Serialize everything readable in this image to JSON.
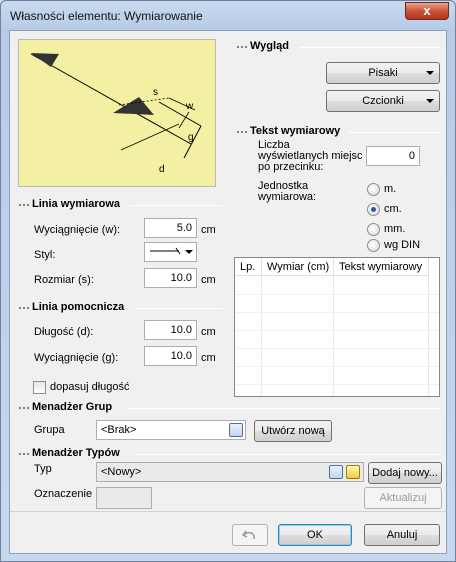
{
  "window": {
    "title": "Własności elementu: Wymiarowanie",
    "close_label": "x"
  },
  "preview": {
    "labels": {
      "s": "s",
      "w": "w",
      "g": "g",
      "d": "d"
    }
  },
  "appearance": {
    "heading": "Wygląd",
    "pens_label": "Pisaki",
    "fonts_label": "Czcionki"
  },
  "dim_text": {
    "heading": "Tekst wymiarowy",
    "decimals_label_1": "Liczba",
    "decimals_label_2": "wyświetlanych miejsc",
    "decimals_label_3": "po przecinku:",
    "decimals_value": "0",
    "unit_label_1": "Jednostka",
    "unit_label_2": "wymiarowa:",
    "units": [
      {
        "label": "m.",
        "checked": false
      },
      {
        "label": "cm.",
        "checked": true
      },
      {
        "label": "mm.",
        "checked": false
      },
      {
        "label": "wg DIN",
        "checked": false
      }
    ]
  },
  "dim_line": {
    "heading": "Linia wymiarowa",
    "extension_label": "Wyciągnięcie (w):",
    "extension_value": "5.0",
    "extension_unit": "cm",
    "style_label": "Styl:",
    "size_label": "Rozmiar (s):",
    "size_value": "10.0",
    "size_unit": "cm"
  },
  "aux_line": {
    "heading": "Linia pomocnicza",
    "length_label": "Długość (d):",
    "length_value": "10.0",
    "length_unit": "cm",
    "extension_label": "Wyciągnięcie (g):",
    "extension_value": "10.0",
    "extension_unit": "cm",
    "fit_label": "dopasuj długość",
    "fit_checked": false
  },
  "table": {
    "columns": [
      "Lp.",
      "Wymiar (cm)",
      "Tekst wymiarowy"
    ],
    "rows": []
  },
  "group_manager": {
    "heading": "Menadżer Grup",
    "group_label": "Grupa",
    "group_value": "<Brak>",
    "create_label": "Utwórz nową"
  },
  "type_manager": {
    "heading": "Menadżer Typów",
    "type_label": "Typ",
    "type_value": "<Nowy>",
    "add_label": "Dodaj nowy...",
    "mark_label": "Oznaczenie",
    "update_label": "Aktualizuj"
  },
  "footer": {
    "ok_label": "OK",
    "cancel_label": "Anuluj",
    "undo_icon": "undo-icon"
  },
  "colors": {
    "preview_bg": "#f4f0a3",
    "accent": "#2a5aa6"
  }
}
